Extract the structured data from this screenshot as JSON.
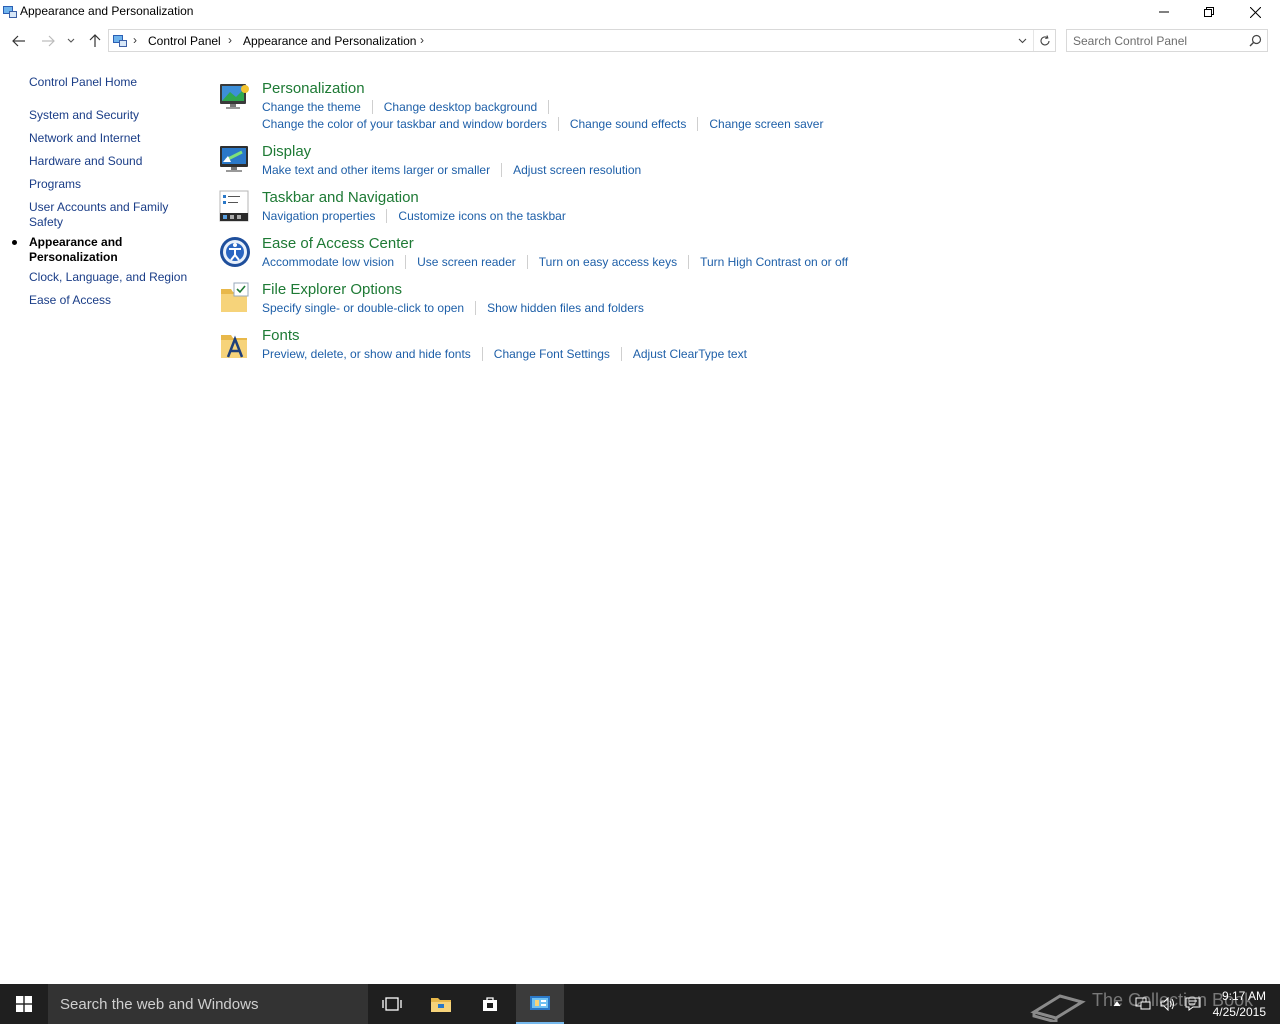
{
  "window": {
    "title": "Appearance and Personalization",
    "controls": [
      "minimize",
      "restore",
      "close"
    ]
  },
  "address": {
    "breadcrumbs": [
      "Control Panel",
      "Appearance and Personalization"
    ],
    "search_placeholder": "Search Control Panel"
  },
  "leftnav": {
    "home": "Control Panel Home",
    "items": [
      "System and Security",
      "Network and Internet",
      "Hardware and Sound",
      "Programs",
      "User Accounts and Family Safety",
      "Appearance and Personalization",
      "Clock, Language, and Region",
      "Ease of Access"
    ],
    "current": "Appearance and Personalization"
  },
  "categories": [
    {
      "title": "Personalization",
      "icon": "personalization-icon",
      "links": [
        [
          "Change the theme",
          "Change desktop background"
        ],
        [
          "Change the color of your taskbar and window borders",
          "Change sound effects",
          "Change screen saver"
        ]
      ]
    },
    {
      "title": "Display",
      "icon": "display-icon",
      "links": [
        [
          "Make text and other items larger or smaller",
          "Adjust screen resolution"
        ]
      ]
    },
    {
      "title": "Taskbar and Navigation",
      "icon": "taskbar-icon",
      "links": [
        [
          "Navigation properties",
          "Customize icons on the taskbar"
        ]
      ]
    },
    {
      "title": "Ease of Access Center",
      "icon": "ease-of-access-icon",
      "links": [
        [
          "Accommodate low vision",
          "Use screen reader",
          "Turn on easy access keys",
          "Turn High Contrast on or off"
        ]
      ]
    },
    {
      "title": "File Explorer Options",
      "icon": "folder-options-icon",
      "links": [
        [
          "Specify single- or double-click to open",
          "Show hidden files and folders"
        ]
      ]
    },
    {
      "title": "Fonts",
      "icon": "fonts-folder-icon",
      "links": [
        [
          "Preview, delete, or show and hide fonts",
          "Change Font Settings",
          "Adjust ClearType text"
        ]
      ]
    }
  ],
  "taskbar": {
    "search_text": "Search the web and Windows",
    "time": "9:17 AM",
    "date": "4/25/2015",
    "watermark": "The Collection Book"
  },
  "colors": {
    "category_title": "#1e7a35",
    "link": "#1e5fa8",
    "nav_link": "#1a3d87",
    "taskbar": "#1f1f1f"
  }
}
